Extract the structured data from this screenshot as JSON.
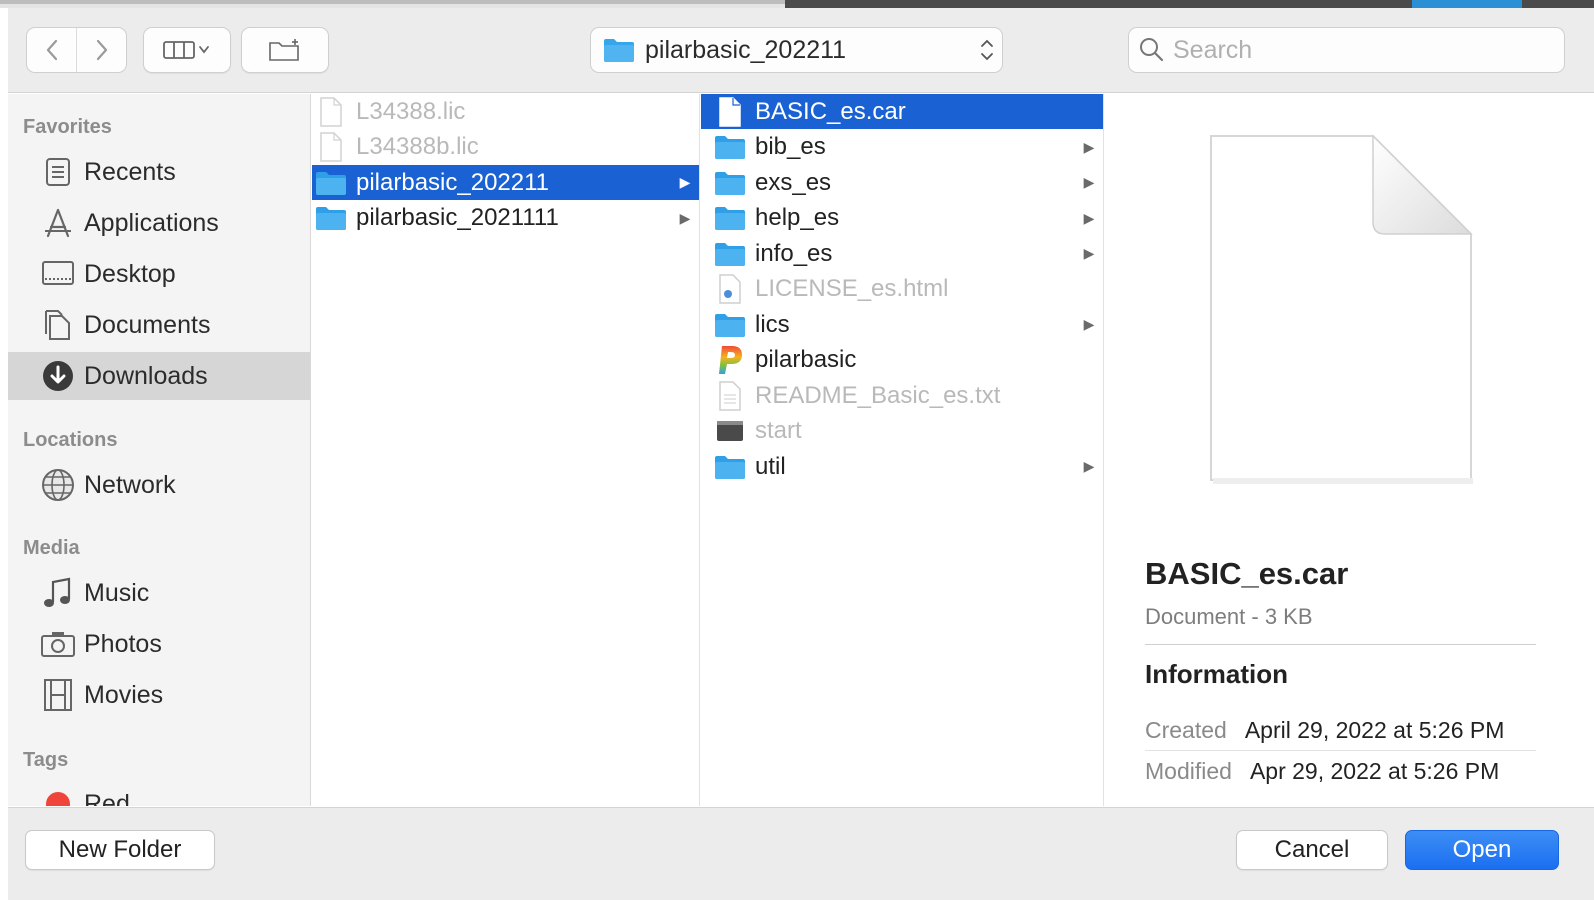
{
  "toolbar": {
    "back_icon": "chevron-left-icon",
    "forward_icon": "chevron-right-icon",
    "view_icon": "column-view-icon",
    "new_folder_icon": "new-folder-icon",
    "path_label": "pilarbasic_202211",
    "search_placeholder": "Search"
  },
  "sidebar": {
    "sections": [
      {
        "heading": "Favorites"
      },
      {
        "heading": "Locations"
      },
      {
        "heading": "Media"
      },
      {
        "heading": "Tags"
      }
    ],
    "items": [
      {
        "label": "Recents",
        "icon": "clock-icon"
      },
      {
        "label": "Applications",
        "icon": "applications-icon"
      },
      {
        "label": "Desktop",
        "icon": "desktop-icon"
      },
      {
        "label": "Documents",
        "icon": "documents-icon"
      },
      {
        "label": "Downloads",
        "icon": "downloads-icon",
        "selected": true
      },
      {
        "label": "Network",
        "icon": "globe-icon"
      },
      {
        "label": "Music",
        "icon": "music-note-icon"
      },
      {
        "label": "Photos",
        "icon": "camera-icon"
      },
      {
        "label": "Movies",
        "icon": "film-icon"
      },
      {
        "label": "Red",
        "icon": "red-tag-icon",
        "color": "#f0443a"
      }
    ]
  },
  "column1": [
    {
      "name": "L34388.lic",
      "type": "file",
      "dim": true
    },
    {
      "name": "L34388b.lic",
      "type": "file",
      "dim": true
    },
    {
      "name": "pilarbasic_202211",
      "type": "folder",
      "selected": true
    },
    {
      "name": "pilarbasic_2021111",
      "type": "folder"
    }
  ],
  "column2": [
    {
      "name": "BASIC_es.car",
      "type": "file",
      "selected": true
    },
    {
      "name": "bib_es",
      "type": "folder"
    },
    {
      "name": "exs_es",
      "type": "folder"
    },
    {
      "name": "help_es",
      "type": "folder"
    },
    {
      "name": "info_es",
      "type": "folder"
    },
    {
      "name": "LICENSE_es.html",
      "type": "html",
      "dim": true
    },
    {
      "name": "lics",
      "type": "folder"
    },
    {
      "name": "pilarbasic",
      "type": "app"
    },
    {
      "name": "README_Basic_es.txt",
      "type": "text",
      "dim": true
    },
    {
      "name": "start",
      "type": "exec",
      "dim": true
    },
    {
      "name": "util",
      "type": "folder"
    }
  ],
  "preview": {
    "name": "BASIC_es.car",
    "kind": "Document - 3 KB",
    "info_heading": "Information",
    "created_label": "Created",
    "created_value": "April 29, 2022 at 5:26 PM",
    "modified_label": "Modified",
    "modified_value": "Apr 29, 2022 at 5:26 PM"
  },
  "buttons": {
    "new_folder": "New Folder",
    "cancel": "Cancel",
    "open": "Open"
  },
  "colors": {
    "selection": "#1a62d4",
    "folder": "#35a6ec",
    "primary_button": "#1b6ff0"
  }
}
